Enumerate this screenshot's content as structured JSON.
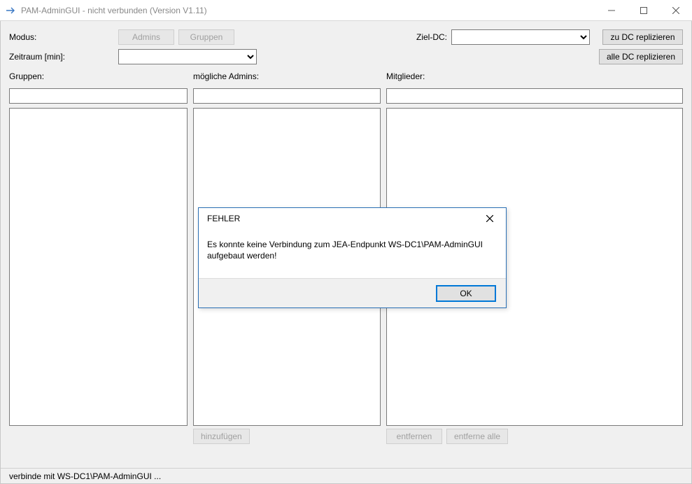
{
  "window": {
    "title": "PAM-AdminGUI - nicht verbunden (Version V1.11)"
  },
  "labels": {
    "modus": "Modus:",
    "zeitraum": "Zeitraum [min]:",
    "ziel_dc": "Ziel-DC:",
    "gruppen": "Gruppen:",
    "moegliche_admins": "mögliche Admins:",
    "mitglieder": "Mitglieder:"
  },
  "buttons": {
    "admins": "Admins",
    "gruppen": "Gruppen",
    "zu_dc": "zu DC replizieren",
    "alle_dc": "alle DC replizieren",
    "hinzufuegen": "hinzufügen",
    "entfernen": "entfernen",
    "entferne_alle": "entferne alle"
  },
  "combos": {
    "zeitraum_value": "",
    "ziel_dc_value": ""
  },
  "status": "verbinde mit WS-DC1\\PAM-AdminGUI ...",
  "dialog": {
    "title": "FEHLER",
    "message": "Es konnte keine Verbindung zum JEA-Endpunkt WS-DC1\\PAM-AdminGUI aufgebaut werden!",
    "ok": "OK"
  }
}
